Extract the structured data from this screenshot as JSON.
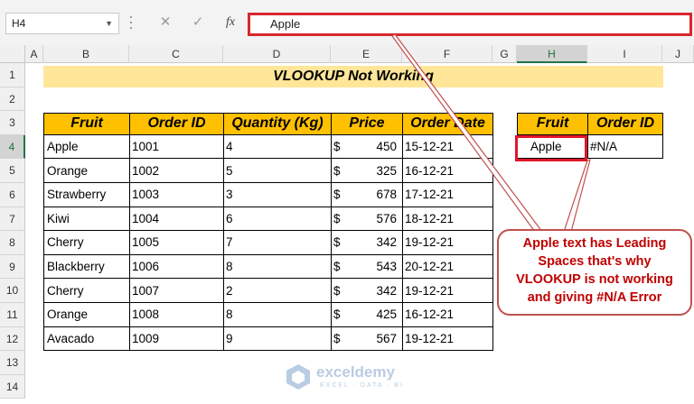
{
  "formula_bar": {
    "name_box": "H4",
    "formula_value": "Apple",
    "fx_label": "fx",
    "cancel_glyph": "✕",
    "enter_glyph": "✓"
  },
  "columns": [
    "A",
    "B",
    "C",
    "D",
    "E",
    "F",
    "G",
    "H",
    "I",
    "J"
  ],
  "rows": [
    "1",
    "2",
    "3",
    "4",
    "5",
    "6",
    "7",
    "8",
    "9",
    "10",
    "11",
    "12",
    "13",
    "14"
  ],
  "selected_cell": "H4",
  "title": "VLOOKUP Not Working",
  "table_headers": [
    "Fruit",
    "Order ID",
    "Quantity (Kg)",
    "Price",
    "Order Date"
  ],
  "table_rows": [
    {
      "fruit": "Apple",
      "order_id": "1001",
      "qty": "4",
      "currency": "$",
      "price": "450",
      "date": "15-12-21"
    },
    {
      "fruit": "Orange",
      "order_id": "1002",
      "qty": "5",
      "currency": "$",
      "price": "325",
      "date": "16-12-21"
    },
    {
      "fruit": "Strawberry",
      "order_id": "1003",
      "qty": "3",
      "currency": "$",
      "price": "678",
      "date": "17-12-21"
    },
    {
      "fruit": "Kiwi",
      "order_id": "1004",
      "qty": "6",
      "currency": "$",
      "price": "576",
      "date": "18-12-21"
    },
    {
      "fruit": "Cherry",
      "order_id": "1005",
      "qty": "7",
      "currency": "$",
      "price": "342",
      "date": "19-12-21"
    },
    {
      "fruit": "Blackberry",
      "order_id": "1006",
      "qty": "8",
      "currency": "$",
      "price": "543",
      "date": "20-12-21"
    },
    {
      "fruit": "Cherry",
      "order_id": "1007",
      "qty": "2",
      "currency": "$",
      "price": "342",
      "date": "19-12-21"
    },
    {
      "fruit": "Orange",
      "order_id": "1008",
      "qty": "8",
      "currency": "$",
      "price": "425",
      "date": "16-12-21"
    },
    {
      "fruit": "Avacado",
      "order_id": "1009",
      "qty": "9",
      "currency": "$",
      "price": "567",
      "date": "19-12-21"
    }
  ],
  "lookup": {
    "headers": [
      "Fruit",
      "Order ID"
    ],
    "fruit": "Apple",
    "result": "#N/A"
  },
  "callout": {
    "lines": [
      "Apple text has Leading",
      "Spaces that's why",
      "VLOOKUP is not working",
      "and giving #N/A Error"
    ]
  },
  "watermark": {
    "name": "exceldemy",
    "tagline": "EXCEL · DATA · BI"
  },
  "colors": {
    "header_fill": "#ffc000",
    "title_fill": "#ffe699",
    "highlight": "#e0162b",
    "callout_text": "#c00000"
  }
}
